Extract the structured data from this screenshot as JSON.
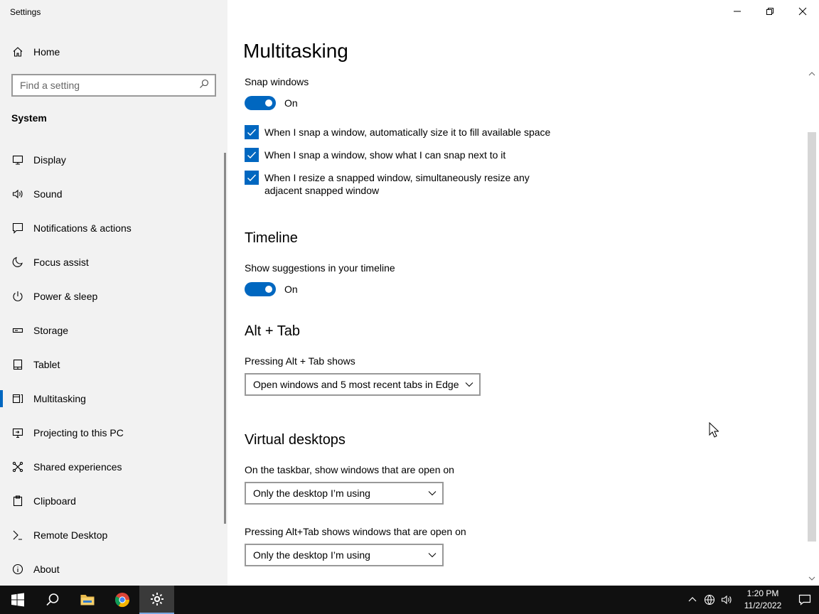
{
  "window": {
    "title": "Settings"
  },
  "sidebar": {
    "home_label": "Home",
    "search_placeholder": "Find a setting",
    "section_label": "System",
    "items": [
      {
        "label": "Display",
        "icon": "monitor-icon"
      },
      {
        "label": "Sound",
        "icon": "speaker-icon"
      },
      {
        "label": "Notifications & actions",
        "icon": "notification-icon"
      },
      {
        "label": "Focus assist",
        "icon": "moon-icon"
      },
      {
        "label": "Power & sleep",
        "icon": "power-icon"
      },
      {
        "label": "Storage",
        "icon": "storage-icon"
      },
      {
        "label": "Tablet",
        "icon": "tablet-icon"
      },
      {
        "label": "Multitasking",
        "icon": "multitasking-icon",
        "active": true
      },
      {
        "label": "Projecting to this PC",
        "icon": "projector-icon"
      },
      {
        "label": "Shared experiences",
        "icon": "shared-icon"
      },
      {
        "label": "Clipboard",
        "icon": "clipboard-icon"
      },
      {
        "label": "Remote Desktop",
        "icon": "remote-desktop-icon"
      },
      {
        "label": "About",
        "icon": "info-icon"
      }
    ]
  },
  "main": {
    "title": "Multitasking",
    "snap": {
      "label": "Snap windows",
      "toggle_state": "On",
      "options": [
        "When I snap a window, automatically size it to fill available space",
        "When I snap a window, show what I can snap next to it",
        "When I resize a snapped window, simultaneously resize any adjacent snapped window"
      ]
    },
    "timeline": {
      "heading": "Timeline",
      "label": "Show suggestions in your timeline",
      "toggle_state": "On"
    },
    "alttab": {
      "heading": "Alt + Tab",
      "label": "Pressing Alt + Tab shows",
      "value": "Open windows and 5 most recent tabs in Edge"
    },
    "virtual_desktops": {
      "heading": "Virtual desktops",
      "taskbar_label": "On the taskbar, show windows that are open on",
      "taskbar_value": "Only the desktop I’m using",
      "alttab_label": "Pressing Alt+Tab shows windows that are open on",
      "alttab_value": "Only the desktop I’m using"
    }
  },
  "taskbar": {
    "time": "1:20 PM",
    "date": "11/2/2022"
  },
  "colors": {
    "accent": "#0067c0",
    "sidebar_bg": "#f2f2f2",
    "taskbar_bg": "#101010"
  }
}
